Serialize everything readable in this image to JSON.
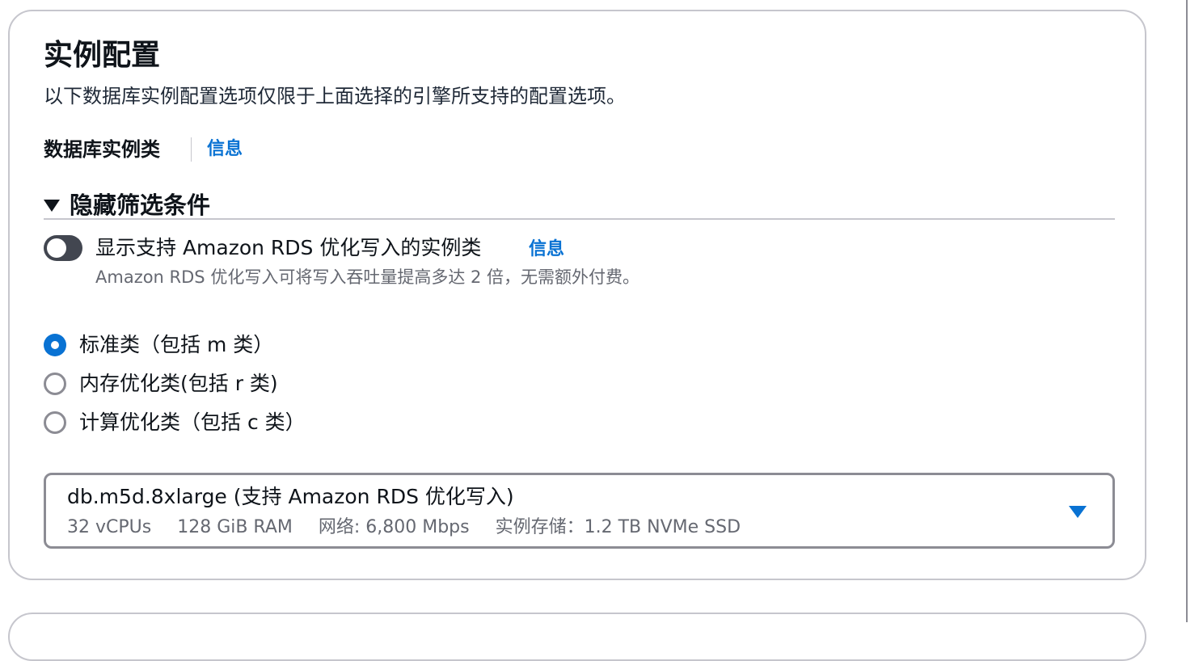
{
  "section": {
    "title": "实例配置",
    "subtitle": "以下数据库实例配置选项仅限于上面选择的引擎所支持的配置选项。"
  },
  "instance_class": {
    "label": "数据库实例类",
    "info_link": "信息"
  },
  "filters": {
    "expander_label": "隐藏筛选条件",
    "expanded": true,
    "toggle": {
      "label": "显示支持 Amazon RDS 优化写入的实例类",
      "info_link": "信息",
      "description": "Amazon RDS 优化写入可将写入吞吐量提高多达 2 倍，无需额外付费。",
      "checked": false
    }
  },
  "class_options": [
    {
      "label": "标准类（包括 m 类）",
      "selected": true
    },
    {
      "label": "内存优化类(包括 r 类)",
      "selected": false
    },
    {
      "label": "计算优化类（包括 c 类）",
      "selected": false
    }
  ],
  "instance_select": {
    "value": "db.m5d.8xlarge (支持 Amazon RDS 优化写入)",
    "details": [
      "32 vCPUs",
      "128 GiB RAM",
      "网络: 6,800 Mbps",
      "实例存储：1.2 TB NVMe SSD"
    ]
  },
  "colors": {
    "accent": "#0972d3",
    "text": "#0f141a",
    "secondary_text": "#656871",
    "border": "#c6c6cd",
    "toggle_off": "#424650"
  }
}
